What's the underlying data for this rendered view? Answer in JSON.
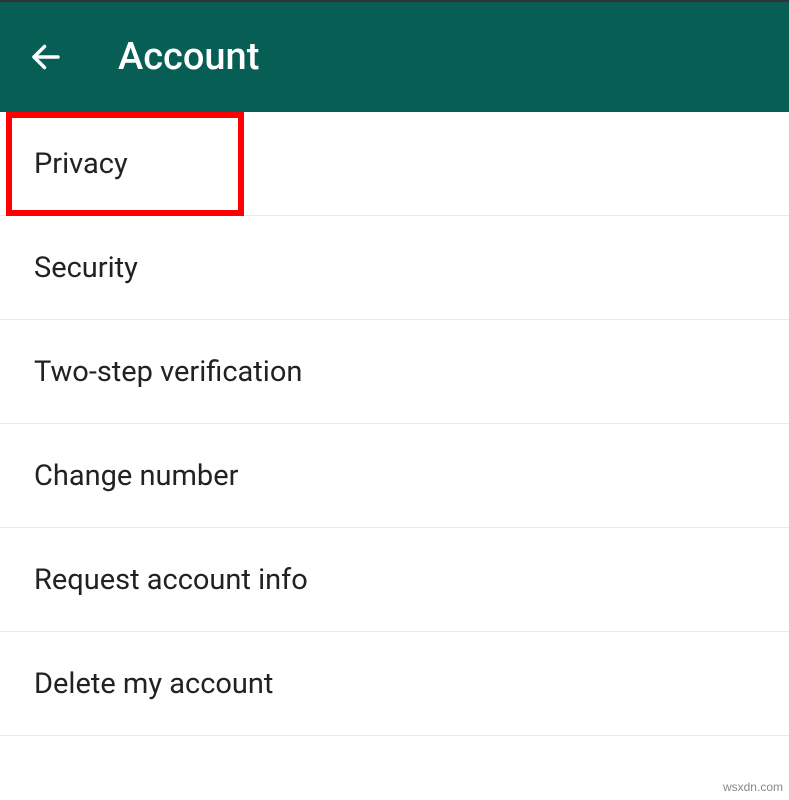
{
  "header": {
    "title": "Account"
  },
  "items": [
    {
      "label": "Privacy"
    },
    {
      "label": "Security"
    },
    {
      "label": "Two-step verification"
    },
    {
      "label": "Change number"
    },
    {
      "label": "Request account info"
    },
    {
      "label": "Delete my account"
    }
  ],
  "watermark": "wsxdn.com"
}
